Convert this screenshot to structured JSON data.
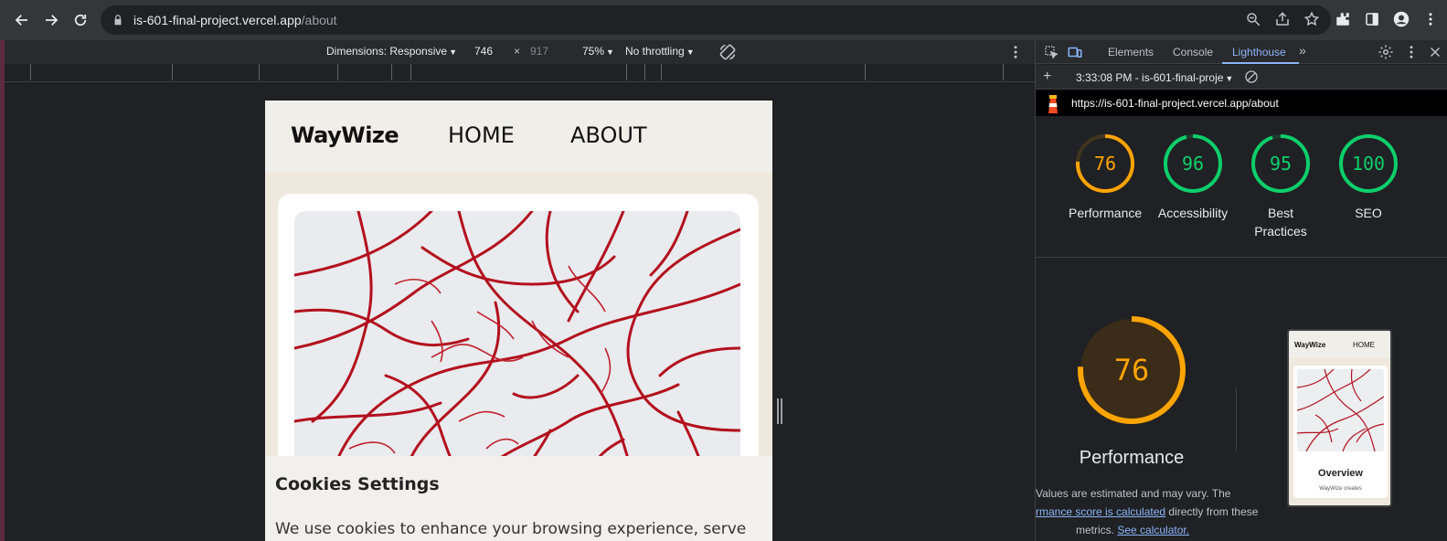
{
  "browser": {
    "url_host": "is-601-final-project.vercel.app",
    "url_path": "/about"
  },
  "device_toolbar": {
    "dimensions_label": "Dimensions: Responsive",
    "width": "746",
    "times": "×",
    "height": "917",
    "zoom": "75%",
    "throttling": "No throttling"
  },
  "page": {
    "logo": "WayWize",
    "nav": [
      "HOME",
      "ABOUT"
    ],
    "cookie_title": "Cookies Settings",
    "cookie_text": "We use cookies to enhance your browsing experience, serve"
  },
  "devtools": {
    "tabs": [
      "Elements",
      "Console",
      "Lighthouse"
    ],
    "active_tab": "Lighthouse",
    "report_time": "3:33:08 PM - is-601-final-proje",
    "report_url": "https://is-601-final-project.vercel.app/about",
    "scores": [
      {
        "value": 76,
        "label": "Performance",
        "color": "#ffa400"
      },
      {
        "value": 96,
        "label": "Accessibility",
        "color": "#0cce6b"
      },
      {
        "value": 95,
        "label": "Best Practices",
        "color": "#0cce6b"
      },
      {
        "value": 100,
        "label": "SEO",
        "color": "#0cce6b"
      }
    ],
    "big_score": "76",
    "big_label": "Performance",
    "note_line1": "Values are estimated and may vary. The",
    "note_link1": "rmance score is calculated",
    "note_line2_rest": " directly from these",
    "note_line3_prefix": "metrics. ",
    "note_link2": "See calculator.",
    "thumb_logo": "WayWize",
    "thumb_nav": "HOME",
    "thumb_title": "Overview",
    "thumb_text": "WayWize creates"
  }
}
